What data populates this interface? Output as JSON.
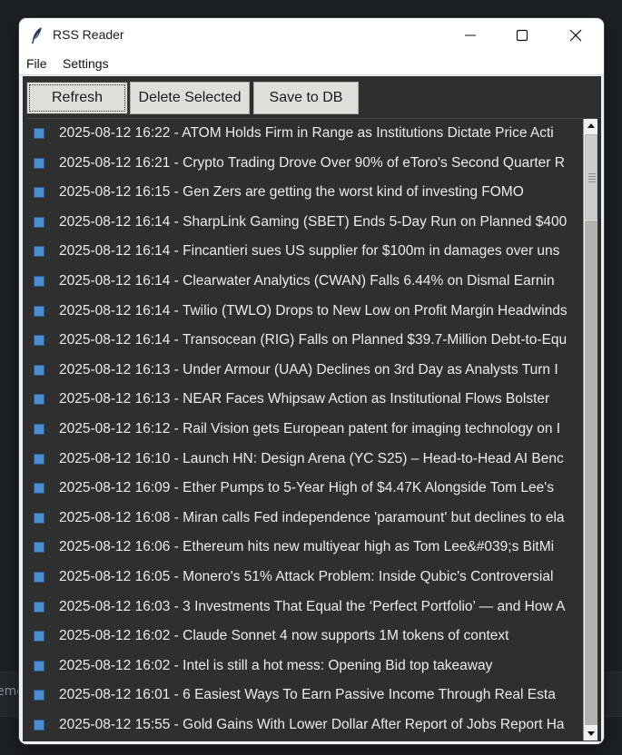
{
  "background": {
    "partial_text": "eme"
  },
  "window": {
    "title": "RSS Reader",
    "app_icon": "feather-icon"
  },
  "menu": {
    "file": "File",
    "settings": "Settings"
  },
  "toolbar": {
    "refresh_label": "Refresh",
    "delete_label": "Delete Selected",
    "save_label": "Save to DB"
  },
  "items": [
    "2025-08-12 16:22 - ATOM Holds Firm in Range as Institutions Dictate Price Acti",
    "2025-08-12 16:21 - Crypto Trading Drove Over 90% of eToro's Second Quarter R",
    "2025-08-12 16:15 - Gen Zers are getting the worst kind of investing FOMO",
    "2025-08-12 16:14 - SharpLink Gaming (SBET) Ends 5-Day Run on Planned $400",
    "2025-08-12 16:14 - Fincantieri sues US supplier for $100m in damages over uns",
    "2025-08-12 16:14 - Clearwater Analytics (CWAN) Falls 6.44% on Dismal Earnin",
    "2025-08-12 16:14 - Twilio (TWLO) Drops to New Low on Profit Margin Headwinds",
    "2025-08-12 16:14 - Transocean (RIG) Falls on Planned $39.7-Million Debt-to-Equ",
    "2025-08-12 16:13 - Under Armour (UAA) Declines on 3rd Day as Analysts Turn I",
    "2025-08-12 16:13 - NEAR Faces Whipsaw Action as Institutional Flows Bolster",
    "2025-08-12 16:12 - Rail Vision gets European patent for imaging technology on I",
    "2025-08-12 16:10 - Launch HN: Design Arena (YC S25) – Head-to-Head AI Benc",
    "2025-08-12 16:09 - Ether Pumps to 5-Year High of $4.47K Alongside Tom Lee's",
    "2025-08-12 16:08 - Miran calls Fed independence 'paramount' but declines to ela",
    "2025-08-12 16:06 - Ethereum hits new multiyear high as Tom Lee&#039;s BitMi",
    "2025-08-12 16:05 - Monero's 51% Attack Problem: Inside Qubic's Controversial",
    "2025-08-12 16:03 - 3 Investments That Equal the ‘Perfect Portfolio’ — and How A",
    "2025-08-12 16:02 - Claude Sonnet 4 now supports 1M tokens of context",
    "2025-08-12 16:02 - Intel is still a hot mess: Opening Bid top takeaway",
    "2025-08-12 16:01 - 6 Easiest Ways To Earn Passive Income Through Real Esta",
    "2025-08-12 15:55 - Gold Gains With Lower Dollar After Report of Jobs Report Ha"
  ],
  "colors": {
    "list_background": "#2f2f2f",
    "list_text": "#ececec",
    "checkbox": "#4b8fd0",
    "button_face": "#e1dfdc"
  }
}
